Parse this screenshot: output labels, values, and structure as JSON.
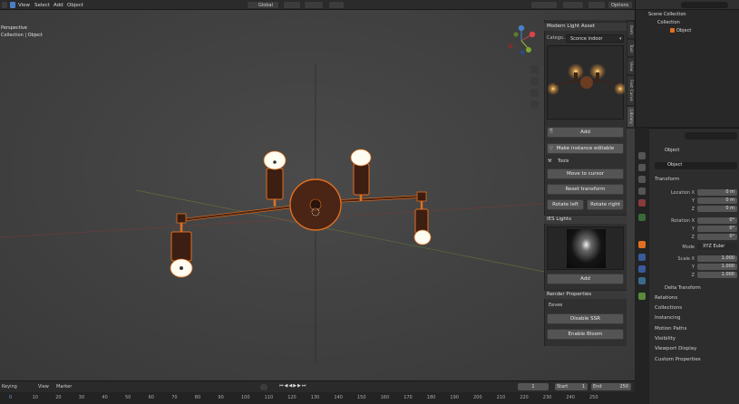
{
  "menubar": {
    "items": [
      "View",
      "Select",
      "Add",
      "Object"
    ],
    "transform_orientation": "Global",
    "options_label": "Options"
  },
  "viewport": {
    "view_name": "Perspective",
    "collection_path": "Collection | Object"
  },
  "npanel": {
    "tabs": [
      "Item",
      "Tool",
      "View",
      "Fast Carve",
      "Library"
    ],
    "asset_title": "Modern Light Asset",
    "category_label": "Catego...",
    "category_value": "Sconce indoor",
    "add_button": "Add",
    "make_editable_button": "Make instance editable",
    "tools_label": "Tools",
    "move_to_cursor_button": "Move to cursor",
    "reset_transform_button": "Reset transform",
    "rotate_left_button": "Rotate left",
    "rotate_right_button": "Rotate right",
    "ies_title": "IES Lights",
    "ies_add_button": "Add",
    "render_title": "Render Properties",
    "eevee_label": "Eevee",
    "disable_ssr_button": "Disable SSR",
    "enable_bloom_button": "Enable Bloom"
  },
  "outliner": {
    "scene_collection": "Scene Collection",
    "collection": "Collection",
    "object": "Object"
  },
  "properties": {
    "object_name": "Object",
    "object_data_name": "Object",
    "transform_title": "Transform",
    "location_label": "Location X",
    "location": [
      "0 m",
      "0 m",
      "0 m"
    ],
    "rotation_label": "Rotation X",
    "rotation": [
      "0°",
      "0°",
      "0°"
    ],
    "mode_label": "Mode",
    "mode_value": "XYZ Euler",
    "scale_label": "Scale X",
    "scale": [
      "1.000",
      "1.000",
      "1.000"
    ],
    "axis_y": "Y",
    "axis_z": "Z",
    "delta_transform": "Delta Transform",
    "sections": [
      "Relations",
      "Collections",
      "Instancing",
      "Motion Paths",
      "Visibility",
      "Viewport Display",
      "Custom Properties"
    ]
  },
  "timeline": {
    "keying_label": "Keying",
    "view_label": "View",
    "marker_label": "Marker",
    "current_frame": "1",
    "start_label": "Start",
    "start_value": "1",
    "end_label": "End",
    "end_value": "250",
    "ruler": [
      "0",
      "10",
      "20",
      "30",
      "40",
      "50",
      "60",
      "70",
      "80",
      "90",
      "100",
      "110",
      "120",
      "130",
      "140",
      "150",
      "160",
      "170",
      "180",
      "190",
      "200",
      "210",
      "220",
      "230",
      "240",
      "250"
    ]
  },
  "colors": {
    "selection_outline": "#e07020",
    "accent_blue": "#4a7fc8",
    "viewport_bg": "#404040"
  }
}
